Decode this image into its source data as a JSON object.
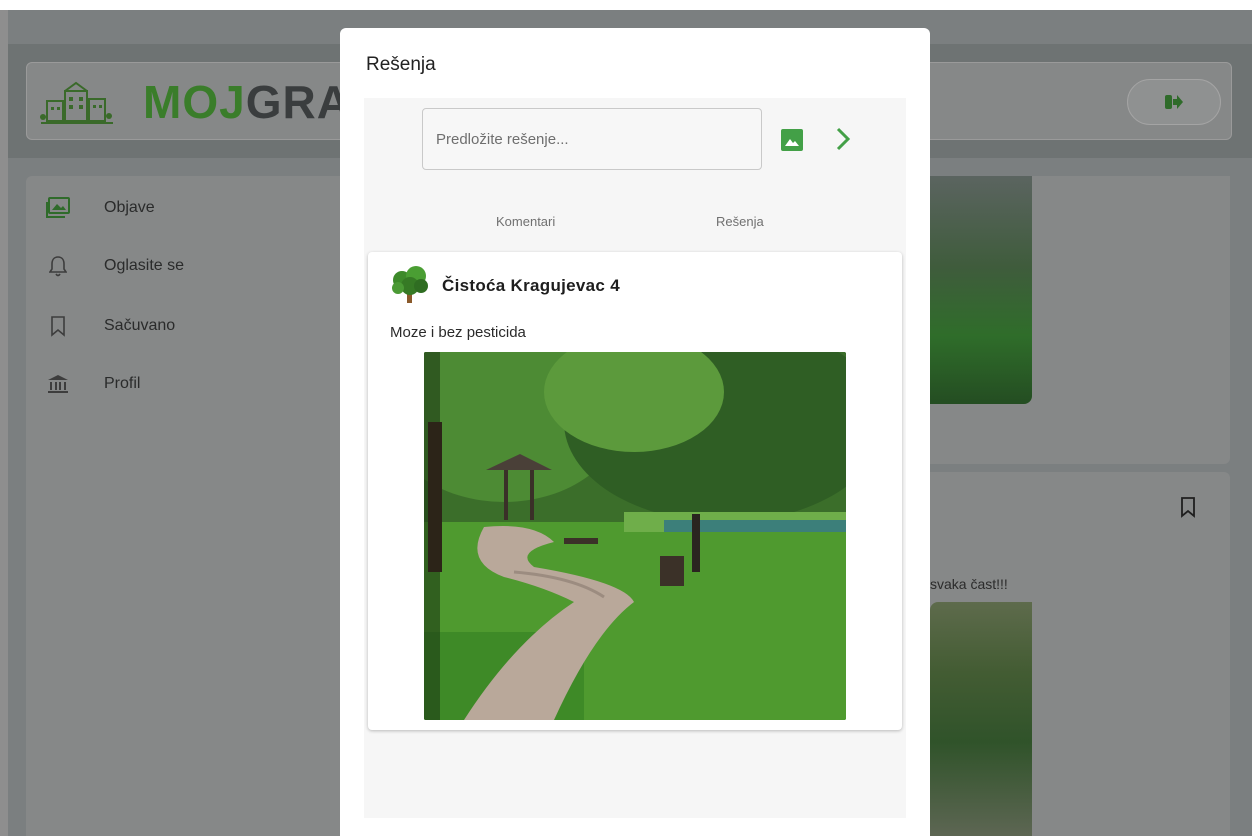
{
  "app": {
    "logo_part1": "MOJ",
    "logo_part2": "GRA"
  },
  "sidebar": {
    "items": [
      {
        "label": "Objave",
        "icon": "photos-icon"
      },
      {
        "label": "Oglasite se",
        "icon": "bell-icon"
      },
      {
        "label": "Sačuvano",
        "icon": "bookmark-icon"
      },
      {
        "label": "Profil",
        "icon": "institution-icon"
      }
    ]
  },
  "feed": {
    "post2_text_fragment": "svaka čast!!!"
  },
  "modal": {
    "title": "Rešenja",
    "input_placeholder": "Predložite rešenje...",
    "tabs": [
      {
        "label": "Komentari"
      },
      {
        "label": "Rešenja"
      }
    ],
    "solution": {
      "author": "Čistoća Kragujevac 4",
      "text": "Moze i bez pesticida"
    }
  },
  "colors": {
    "accent_green": "#43a047",
    "overlay": "#808080"
  }
}
